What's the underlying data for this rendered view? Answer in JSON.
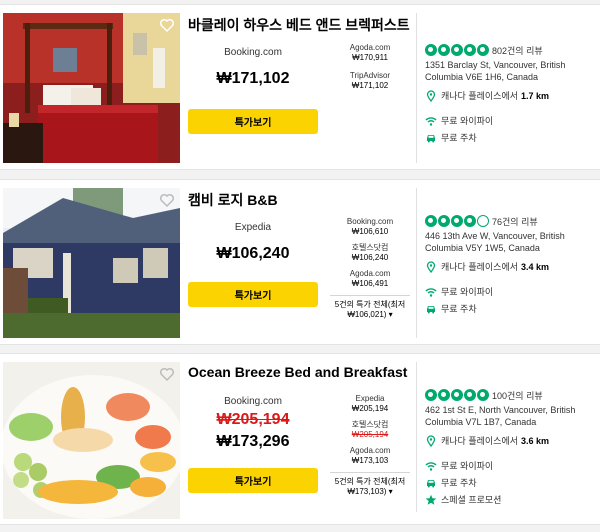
{
  "colors": {
    "deal_button": "#fbd300",
    "rating_green": "#00aa6c",
    "strike_red": "#d91a1a"
  },
  "hotels": [
    {
      "name": "바클레이 하우스 베드 앤드 브렉퍼스트",
      "main_provider": "Booking.com",
      "main_price": "₩171,102",
      "deal_button": "특가보기",
      "side_prices": [
        {
          "provider": "Agoda.com",
          "price": "₩170,911"
        },
        {
          "provider": "TripAdvisor",
          "price": "₩171,102"
        }
      ],
      "rating_bubbles": 5,
      "reviews": "802건의 리뷰",
      "address": "1351 Barclay St, Vancouver, British Columbia V6E 1H6, Canada",
      "distance_label": "캐나다 플레이스에서",
      "distance_value": "1.7 km",
      "amenities": [
        {
          "icon": "wifi-icon",
          "label": "무료 와이파이"
        },
        {
          "icon": "car-icon",
          "label": "무료 주차"
        }
      ]
    },
    {
      "name": "캠비 로지 B&B",
      "main_provider": "Expedia",
      "main_price": "₩106,240",
      "deal_button": "특가보기",
      "side_prices": [
        {
          "provider": "Booking.com",
          "price": "₩106,610"
        },
        {
          "provider": "호텔스닷컴",
          "price": "₩106,240"
        },
        {
          "provider": "Agoda.com",
          "price": "₩106,491"
        }
      ],
      "all_deals": "5건의 특가 전체(최저 ₩106,021) ▾",
      "rating_bubbles": 4,
      "reviews": "76건의 리뷰",
      "address": "446 13th Ave W, Vancouver, British Columbia V5Y 1W5, Canada",
      "distance_label": "캐나다 플레이스에서",
      "distance_value": "3.4 km",
      "amenities": [
        {
          "icon": "wifi-icon",
          "label": "무료 와이파이"
        },
        {
          "icon": "car-icon",
          "label": "무료 주차"
        }
      ]
    },
    {
      "name": "Ocean Breeze Bed and Breakfast",
      "main_provider": "Booking.com",
      "main_price_old": "₩205,194",
      "main_price": "₩173,296",
      "deal_button": "특가보기",
      "side_prices": [
        {
          "provider": "Expedia",
          "price": "₩205,194"
        },
        {
          "provider": "호텔스닷컴",
          "price_old": "₩205,194"
        },
        {
          "provider": "Agoda.com",
          "price": "₩173,103"
        }
      ],
      "all_deals": "5건의 특가 전체(최저 ₩173,103) ▾",
      "rating_bubbles": 5,
      "reviews": "100건의 리뷰",
      "address": "462 1st St E, North Vancouver, British Columbia V7L 1B7, Canada",
      "distance_label": "캐나다 플레이스에서",
      "distance_value": "3.6 km",
      "amenities": [
        {
          "icon": "wifi-icon",
          "label": "무료 와이파이"
        },
        {
          "icon": "car-icon",
          "label": "무료 주차"
        },
        {
          "icon": "star-icon",
          "label": "스페셜 프로모션"
        }
      ]
    }
  ]
}
